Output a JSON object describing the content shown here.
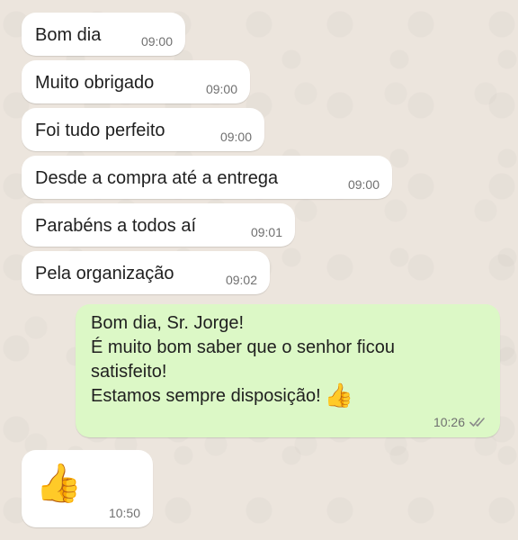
{
  "conversation": {
    "incoming": [
      {
        "text": "Bom dia",
        "time": "09:00"
      },
      {
        "text": "Muito obrigado",
        "time": "09:00"
      },
      {
        "text": "Foi tudo perfeito",
        "time": "09:00"
      },
      {
        "text": "Desde a compra até a entrega",
        "time": "09:00"
      },
      {
        "text": "Parabéns a todos aí",
        "time": "09:01"
      },
      {
        "text": "Pela organização",
        "time": "09:02"
      }
    ],
    "outgoing": {
      "lines": [
        "Bom dia, Sr. Jorge!",
        "É muito bom saber que o senhor ficou",
        "satisfeito!",
        "Estamos sempre disposição!"
      ],
      "emoji": "👍",
      "time": "10:26",
      "status_icon": "double-check-icon"
    },
    "reaction": {
      "emoji": "👍",
      "time": "10:50"
    }
  },
  "colors": {
    "background": "#ece5dd",
    "incoming_bubble": "#ffffff",
    "outgoing_bubble": "#dcf8c6",
    "timestamp": "#707070"
  }
}
